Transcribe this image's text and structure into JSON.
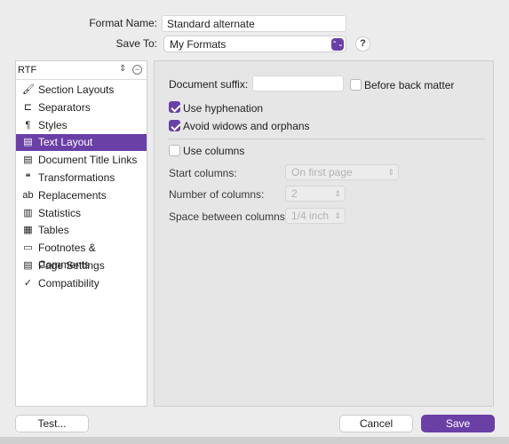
{
  "header": {
    "format_name_label": "Format Name:",
    "format_name_value": "Standard alternate",
    "save_to_label": "Save To:",
    "save_to_value": "My Formats",
    "help_label": "?"
  },
  "sidebar": {
    "selector_value": "RTF",
    "items": [
      {
        "label": "Section Layouts",
        "icon": "paintbrush-icon",
        "glyph": "🖌",
        "selected": false
      },
      {
        "label": "Separators",
        "icon": "separators-icon",
        "glyph": "⊏",
        "selected": false
      },
      {
        "label": "Styles",
        "icon": "styles-icon",
        "glyph": "¶",
        "selected": false
      },
      {
        "label": "Text Layout",
        "icon": "text-layout-icon",
        "glyph": "▤",
        "selected": true
      },
      {
        "label": "Document Title Links",
        "icon": "document-links-icon",
        "glyph": "▤",
        "selected": false
      },
      {
        "label": "Transformations",
        "icon": "transformations-icon",
        "glyph": "❝",
        "selected": false
      },
      {
        "label": "Replacements",
        "icon": "replacements-icon",
        "glyph": "ab",
        "selected": false
      },
      {
        "label": "Statistics",
        "icon": "statistics-icon",
        "glyph": "▥",
        "selected": false
      },
      {
        "label": "Tables",
        "icon": "tables-icon",
        "glyph": "▦",
        "selected": false
      },
      {
        "label": "Footnotes & Comments",
        "icon": "footnotes-icon",
        "glyph": "▭",
        "selected": false
      },
      {
        "label": "Page Settings",
        "icon": "page-settings-icon",
        "glyph": "▤",
        "selected": false
      },
      {
        "label": "Compatibility",
        "icon": "compatibility-icon",
        "glyph": "✓",
        "selected": false
      }
    ]
  },
  "text_layout": {
    "document_suffix_label": "Document suffix:",
    "document_suffix_value": "",
    "before_back_matter_label": "Before back matter",
    "before_back_matter_checked": false,
    "use_hyphenation_label": "Use hyphenation",
    "use_hyphenation_checked": true,
    "avoid_widows_label": "Avoid widows and orphans",
    "avoid_widows_checked": true,
    "use_columns_label": "Use columns",
    "use_columns_checked": false,
    "start_columns_label": "Start columns:",
    "start_columns_value": "On first page",
    "number_of_columns_label": "Number of columns:",
    "number_of_columns_value": "2",
    "space_between_label": "Space between columns:",
    "space_between_value": "1/4 inch"
  },
  "footer": {
    "test_label": "Test...",
    "cancel_label": "Cancel",
    "save_label": "Save"
  },
  "colors": {
    "accent": "#6a3fa6"
  }
}
